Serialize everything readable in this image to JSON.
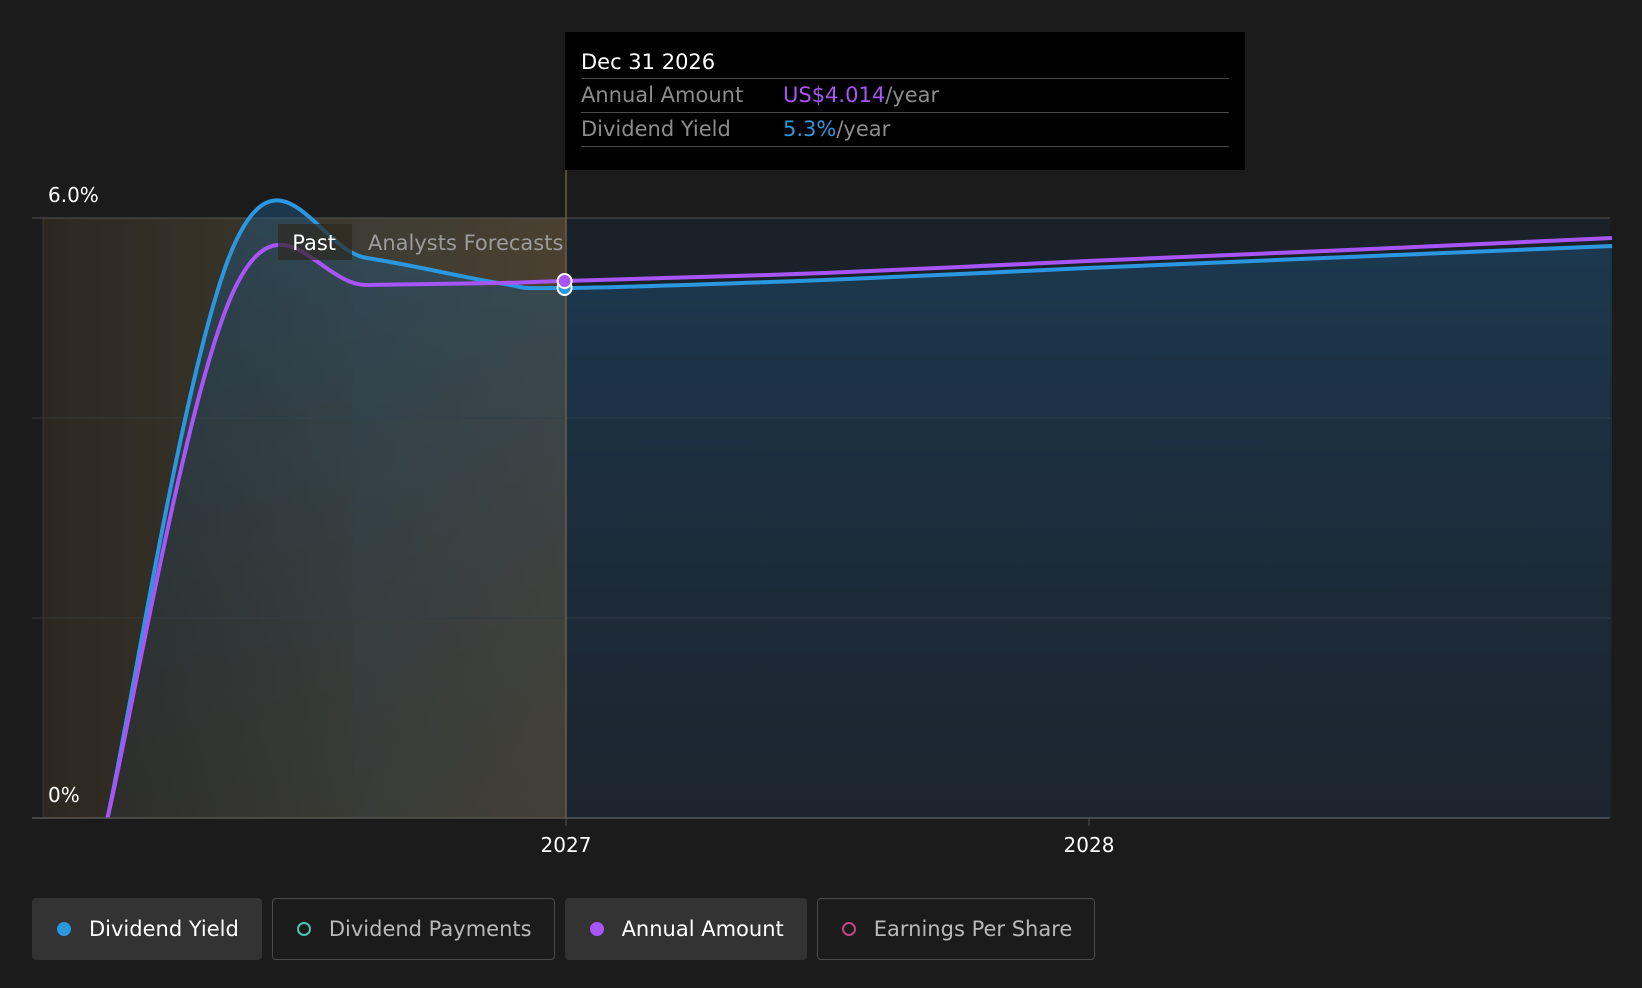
{
  "chart_data": {
    "type": "area",
    "y_ticks": [
      "6.0%",
      "0%"
    ],
    "ylim": [
      0,
      6.0
    ],
    "x_ticks": [
      "2027",
      "2028"
    ],
    "regions": {
      "past_label": "Past",
      "forecast_label": "Analysts Forecasts"
    },
    "series": [
      {
        "name": "Dividend Yield",
        "color": "#2b97e0",
        "x": [
          "2026-02-15",
          "2026-05-15",
          "2026-08-15",
          "2026-11-15",
          "2026-12-31",
          "2027-06-30",
          "2027-12-31",
          "2028-06-30",
          "2028-12-31"
        ],
        "values": [
          0.0,
          5.75,
          5.6,
          5.35,
          5.3,
          5.38,
          5.5,
          5.61,
          5.72
        ]
      },
      {
        "name": "Annual Amount",
        "color": "#a855f7",
        "x": [
          "2026-02-15",
          "2026-05-15",
          "2026-08-15",
          "2026-11-15",
          "2026-12-31",
          "2027-06-30",
          "2027-12-31",
          "2028-06-30",
          "2028-12-31"
        ],
        "values": [
          0.0,
          5.3,
          5.33,
          5.35,
          5.37,
          5.45,
          5.57,
          5.68,
          5.8
        ]
      }
    ],
    "tooltip": {
      "date": "Dec 31 2026",
      "rows": [
        {
          "label": "Annual Amount",
          "value": "US$4.014",
          "unit": "/year"
        },
        {
          "label": "Dividend Yield",
          "value": "5.3%",
          "unit": "/year"
        }
      ]
    }
  },
  "legend": [
    {
      "label": "Dividend Yield",
      "color": "#2b97e0",
      "filled": true,
      "active": true
    },
    {
      "label": "Dividend Payments",
      "color": "#4fc3b1",
      "filled": false,
      "active": false
    },
    {
      "label": "Annual Amount",
      "color": "#a855f7",
      "filled": true,
      "active": true
    },
    {
      "label": "Earnings Per Share",
      "color": "#c2467f",
      "filled": false,
      "active": false
    }
  ]
}
